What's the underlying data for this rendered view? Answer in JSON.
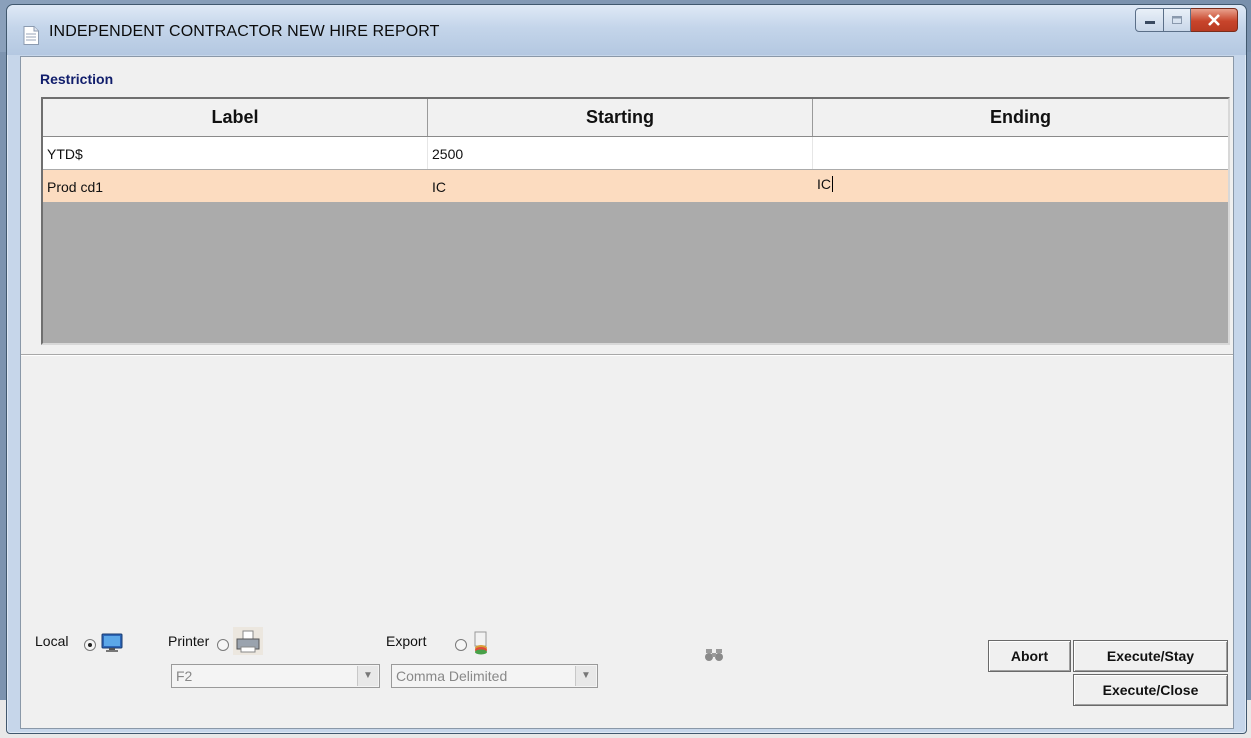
{
  "window": {
    "title": "INDEPENDENT CONTRACTOR NEW HIRE REPORT"
  },
  "restriction": {
    "section_label": "Restriction",
    "columns": [
      "Label",
      "Starting",
      "Ending"
    ],
    "rows": [
      {
        "label": "YTD$",
        "starting": "2500",
        "ending": ""
      },
      {
        "label": "Prod cd1",
        "starting": "IC",
        "ending": "IC"
      }
    ]
  },
  "output": {
    "local_label": "Local",
    "printer_label": "Printer",
    "export_label": "Export",
    "selected": "Local",
    "printer_value": "F2",
    "export_value": "Comma Delimited"
  },
  "buttons": {
    "abort": "Abort",
    "execute_stay": "Execute/Stay",
    "execute_close": "Execute/Close"
  },
  "colors": {
    "selected_row": "#fcdcc0",
    "section_label": "#101d6b",
    "grid_background": "#ababab"
  }
}
